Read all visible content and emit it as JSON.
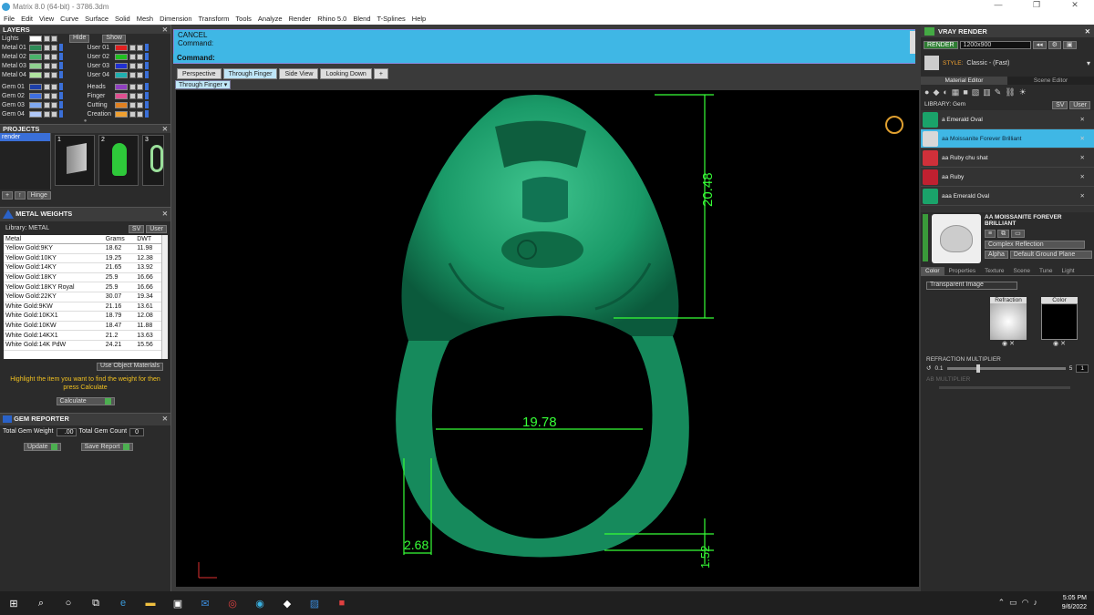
{
  "window": {
    "title": "Matrix 8.0 (64-bit) - 3786.3dm",
    "min": "—",
    "max": "❐",
    "close": "✕"
  },
  "menu": [
    "File",
    "Edit",
    "View",
    "Curve",
    "Surface",
    "Solid",
    "Mesh",
    "Dimension",
    "Transform",
    "Tools",
    "Analyze",
    "Render",
    "Rhino 5.0",
    "Blend",
    "T-Splines",
    "Help"
  ],
  "layers": {
    "title": "LAYERS",
    "lights": "Lights",
    "hide": "Hide",
    "show": "Show",
    "left": [
      {
        "name": "Metal 01",
        "color": "#2e8b57"
      },
      {
        "name": "Metal 02",
        "color": "#4ab36a"
      },
      {
        "name": "Metal 03",
        "color": "#8fd18f"
      },
      {
        "name": "Metal 04",
        "color": "#b0e5a0"
      },
      {
        "name": "Gem 01",
        "color": "#1d3fa8"
      },
      {
        "name": "Gem 02",
        "color": "#3f6fe0"
      },
      {
        "name": "Gem 03",
        "color": "#7fa8f0"
      },
      {
        "name": "Gem 04",
        "color": "#b0c8f8"
      }
    ],
    "right": [
      {
        "name": "User 01",
        "color": "#e02020"
      },
      {
        "name": "User 02",
        "color": "#20c020"
      },
      {
        "name": "User 03",
        "color": "#2030d0"
      },
      {
        "name": "User 04",
        "color": "#20b0b0"
      },
      {
        "name": "Heads",
        "color": "#9040c0"
      },
      {
        "name": "Finger",
        "color": "#e05090"
      },
      {
        "name": "Cutting",
        "color": "#e08020"
      },
      {
        "name": "Creation",
        "color": "#f0a030"
      }
    ]
  },
  "projects": {
    "title": "PROJECTS",
    "item": "render",
    "hinge": "Hinge",
    "thumbs": [
      "1",
      "2",
      "3"
    ]
  },
  "metal_weights": {
    "title": "METAL WEIGHTS",
    "library": "Library: METAL",
    "sv": "SV",
    "user": "User",
    "cols": [
      "Metal",
      "Grams",
      "DWT"
    ],
    "rows": [
      [
        "Yellow Gold:9KY",
        "18.62",
        "11.98"
      ],
      [
        "Yellow Gold:10KY",
        "19.25",
        "12.38"
      ],
      [
        "Yellow Gold:14KY",
        "21.65",
        "13.92"
      ],
      [
        "Yellow Gold:18KY",
        "25.9",
        "16.66"
      ],
      [
        "Yellow Gold:18KY Royal",
        "25.9",
        "16.66"
      ],
      [
        "Yellow Gold:22KY",
        "30.07",
        "19.34"
      ],
      [
        "White Gold:9KW",
        "21.16",
        "13.61"
      ],
      [
        "White Gold:10KX1",
        "18.79",
        "12.08"
      ],
      [
        "White Gold:10KW",
        "18.47",
        "11.88"
      ],
      [
        "White Gold:14KX1",
        "21.2",
        "13.63"
      ],
      [
        "White Gold:14K PdW",
        "24.21",
        "15.56"
      ]
    ],
    "use_obj": "Use Object Materials",
    "hint": "Highlight the item you want to find the weight for then press Calculate",
    "calculate": "Calculate"
  },
  "gem_reporter": {
    "title": "GEM REPORTER",
    "total_weight_label": "Total Gem Weight",
    "total_weight": ".00",
    "total_count_label": "Total Gem Count",
    "total_count": "0",
    "update": "Update",
    "save": "Save Report"
  },
  "command": {
    "line1": "CANCEL",
    "line2": "Command:",
    "prompt": "Command:"
  },
  "viewtabs": [
    "Perspective",
    "Through Finger",
    "Side View",
    "Looking Down",
    "+"
  ],
  "subtab": "Through Finger",
  "dims": {
    "height": "20.48",
    "width": "19.78",
    "band": "2.68",
    "thick": "1.52"
  },
  "vray": {
    "title": "VRAY RENDER",
    "render": "RENDER",
    "res": "1200x900",
    "style_label": "STYLE:",
    "style": "Classic - (Fast)",
    "tabs": [
      "Material Editor",
      "Scene Editor"
    ],
    "library": "LIBRARY: Gem",
    "sv": "SV",
    "user": "User",
    "materials": [
      {
        "name": "a Emerald Oval",
        "color": "#1aa36a",
        "sel": false
      },
      {
        "name": "aa Moissanite Forever Brilliant",
        "color": "#d8d8d8",
        "sel": true
      },
      {
        "name": "aa Ruby chu shat",
        "color": "#d0303a",
        "sel": false
      },
      {
        "name": "aa Ruby",
        "color": "#c02030",
        "sel": false
      },
      {
        "name": "aaa Emerald Oval",
        "color": "#1aa36a",
        "sel": false
      }
    ],
    "preview_name": "AA MOISSANITE FOREVER BRILLIANT",
    "refl": "Complex Reflection",
    "alpha": "Alpha",
    "ground": "Default Ground Plane",
    "subtabs": [
      "Color",
      "Properties",
      "Texture",
      "Scene",
      "Tune",
      "Light"
    ],
    "transparent": "Transparent Image",
    "refraction": "Refraction",
    "color": "Color",
    "mult_label": "REFRACTION MULTIPLIER",
    "mult_min": "0.1",
    "mult_max": "5",
    "mult_val": "1",
    "ab_label": "AB MULTIPLIER"
  },
  "tray": {
    "time": "5:05 PM",
    "date": "9/6/2022"
  }
}
